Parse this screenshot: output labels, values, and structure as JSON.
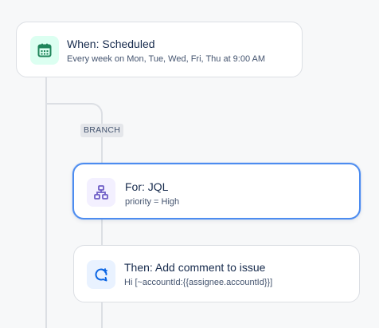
{
  "trigger": {
    "title": "When: Scheduled",
    "subtitle": "Every week on Mon, Tue, Wed, Fri, Thu at 9:00 AM",
    "icon": "calendar-icon",
    "icon_bg": "#dcfff1",
    "icon_color": "#1f845a"
  },
  "branch": {
    "label": "BRANCH"
  },
  "branch_condition": {
    "title": "For: JQL",
    "subtitle": "priority = High",
    "icon": "hierarchy-icon",
    "icon_bg": "#f3f0ff",
    "icon_color": "#6e5dc6",
    "selected": true
  },
  "action": {
    "title": "Then: Add comment to issue",
    "subtitle": "Hi [~accountId:{{assignee.accountId}}]",
    "icon": "comment-icon",
    "icon_bg": "#e9f2ff",
    "icon_color": "#0c66e4"
  },
  "colors": {
    "connector": "#dcdfe4",
    "selected_border": "#4c8cf0"
  }
}
